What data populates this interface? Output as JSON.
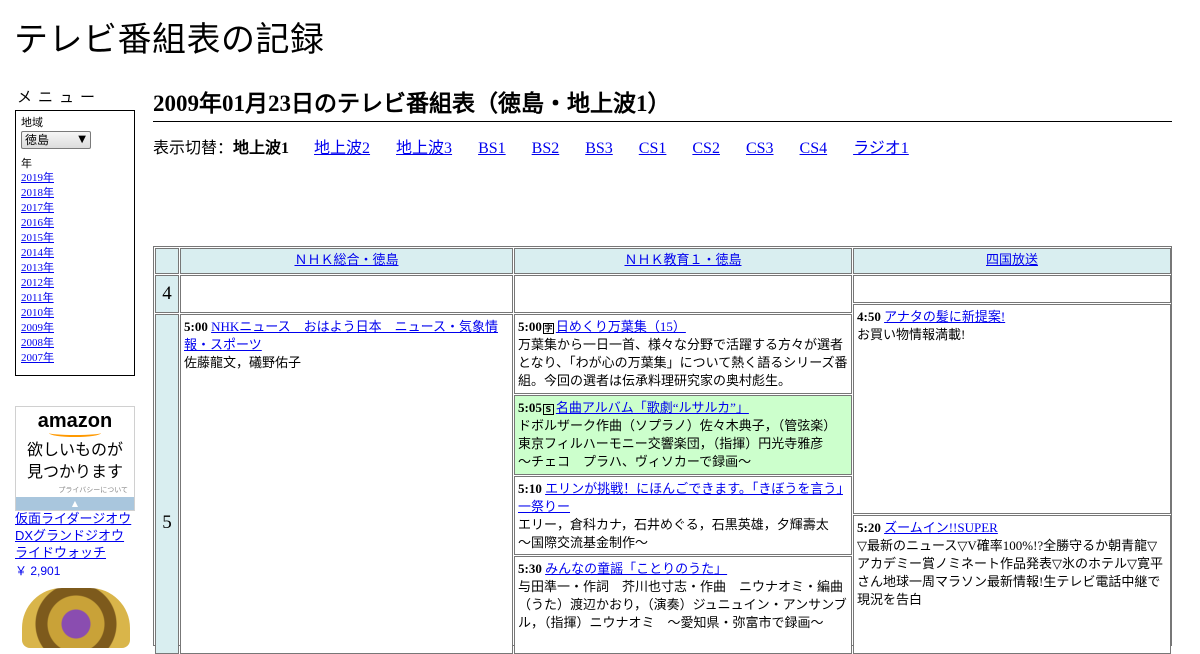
{
  "site": {
    "title": "テレビ番組表の記録"
  },
  "sidebar": {
    "menu_heading": "メニュー",
    "region_label": "地域",
    "region_value": "徳島",
    "year_label": "年",
    "years": [
      "2019年",
      "2018年",
      "2017年",
      "2016年",
      "2015年",
      "2014年",
      "2013年",
      "2012年",
      "2011年",
      "2010年",
      "2009年",
      "2008年",
      "2007年"
    ]
  },
  "ad": {
    "logo": "amazon",
    "line1": "欲しいものが",
    "line2": "見つかります",
    "privacy": "プライバシーについて",
    "product_name": "仮面ライダージオウ DXグランドジオウライドウォッチ",
    "price": "￥ 2,901"
  },
  "main": {
    "title": "2009年01月23日のテレビ番組表（徳島・地上波1）",
    "switch_label": "表示切替：",
    "current": "地上波1",
    "links": [
      "地上波2",
      "地上波3",
      "BS1",
      "BS2",
      "BS3",
      "CS1",
      "CS2",
      "CS3",
      "CS4",
      "ラジオ1"
    ]
  },
  "schedule": {
    "channels": [
      "ＮＨＫ総合・徳島",
      "ＮＨＫ教育１・徳島",
      "四国放送"
    ],
    "hours": [
      "4",
      "5"
    ],
    "programs": {
      "nhk_sogo": [
        {
          "time": "5:00",
          "title": "NHKニュース　おはよう日本　ニュース・気象情報・スポーツ",
          "desc": "佐藤龍文，礒野佑子"
        }
      ],
      "nhk_edu": [
        {
          "time": "5:00",
          "badge": "字",
          "title": "日めくり万葉集（15）",
          "desc": "万葉集から一日一首、様々な分野で活躍する方々が選者となり、「わが心の万葉集」について熱く語るシリーズ番組。今回の選者は伝承料理研究家の奥村彪生。"
        },
        {
          "time": "5:05",
          "badge": "S",
          "title": "名曲アルバム「歌劇“ルサルカ”」",
          "desc": "ドボルザーク作曲（ソプラノ）佐々木典子，（管弦楽）東京フィルハーモニー交響楽団，（指揮）円光寺雅彦　～チェコ　プラハ、ヴィソカーで録画～"
        },
        {
          "time": "5:10",
          "title": "エリンが挑戦！にほんごできます。「きぼうを言う」一祭りー",
          "desc": "エリー，倉科カナ，石井めぐる，石黒英雄，夕輝壽太　～国際交流基金制作～"
        },
        {
          "time": "5:30",
          "title": "みんなの童謡「ことりのうた」",
          "desc": "与田準一・作詞　芥川也寸志・作曲　ニウナオミ・編曲（うた）渡辺かおり，（演奏）ジュニュイン・アンサンブル，（指揮）ニウナオミ　～愛知県・弥富市で録画～"
        }
      ],
      "shikoku": [
        {
          "time": "4:50",
          "title": "アナタの髪に新提案!",
          "desc": "お買い物情報満載!"
        },
        {
          "time": "5:20",
          "title": "ズームイン!!SUPER",
          "desc": "▽最新のニュース▽V確率100%!?全勝守るか朝青龍▽アカデミー賞ノミネート作品発表▽氷のホテル▽寛平さん地球一周マラソン最新情報!生テレビ電話中継で現況を告白"
        }
      ]
    }
  },
  "colors": {
    "header_bg": "#d9eef0",
    "highlight_bg": "#ccffcc",
    "link": "#0000ee"
  }
}
